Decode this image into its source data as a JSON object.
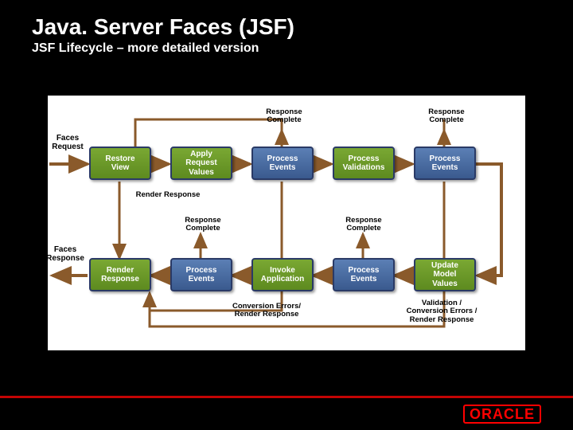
{
  "header": {
    "title": "Java. Server Faces (JSF)",
    "subtitle": "JSF Lifecycle – more detailed version"
  },
  "entry": {
    "faces_request": "Faces\nRequest",
    "faces_response": "Faces\nResponse"
  },
  "phases": {
    "top": [
      {
        "label": "Restore\nView",
        "type": "green"
      },
      {
        "label": "Apply\nRequest\nValues",
        "type": "green"
      },
      {
        "label": "Process\nEvents",
        "type": "blue"
      },
      {
        "label": "Process\nValidations",
        "type": "green"
      },
      {
        "label": "Process\nEvents",
        "type": "blue"
      }
    ],
    "bottom": [
      {
        "label": "Render\nResponse",
        "type": "green"
      },
      {
        "label": "Process\nEvents",
        "type": "blue"
      },
      {
        "label": "Invoke\nApplication",
        "type": "green"
      },
      {
        "label": "Process\nEvents",
        "type": "blue"
      },
      {
        "label": "Update\nModel\nValues",
        "type": "green"
      }
    ]
  },
  "annotations": {
    "response_complete_top3": "Response\nComplete",
    "response_complete_top5": "Response\nComplete",
    "render_response_mid": "Render Response",
    "response_complete_bot3": "Response\nComplete",
    "response_complete_bot5": "Response\nComplete",
    "conversion_errors": "Conversion Errors/\nRender Response",
    "validation_errors": "Validation /\nConversion Errors /\nRender Response"
  },
  "brand": {
    "name": "ORACLE"
  },
  "colors": {
    "green": "#5d8a1f",
    "blue": "#3a5a8e",
    "arrow": "#8a5a2b",
    "red": "#c40404"
  }
}
